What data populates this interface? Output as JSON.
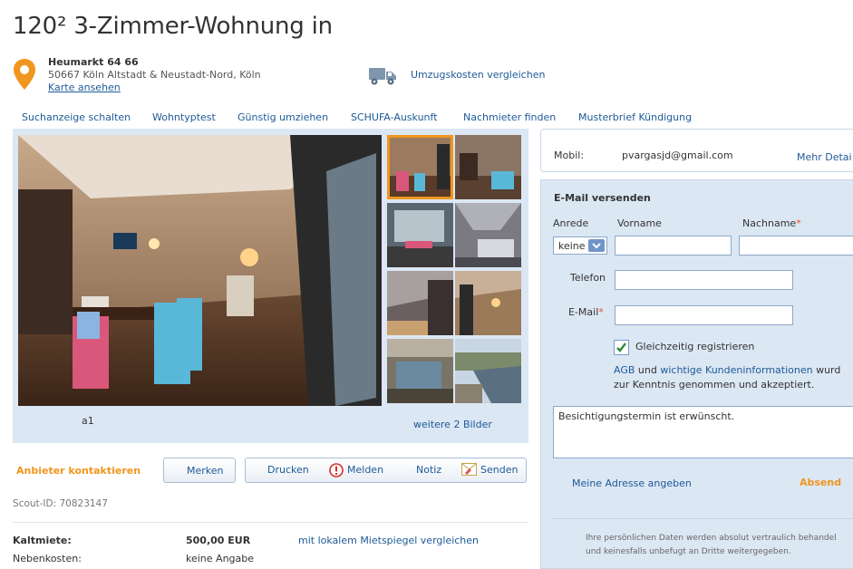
{
  "listing": {
    "title": "120² 3-Zimmer-Wohnung in",
    "street": "Heumarkt 64 66",
    "city": "50667 Köln Altstadt & Neustadt-Nord, Köln",
    "map_link": "Karte ansehen",
    "moving_link": "Umzugskosten vergleichen"
  },
  "nav": {
    "items": [
      "Suchanzeige schalten",
      "Wohntyptest",
      "Günstig umziehen",
      "SCHUFA-Auskunft",
      "Nachmieter finden",
      "Musterbrief Kündigung"
    ]
  },
  "gallery": {
    "caption": "a1",
    "more_link": "weitere 2 Bilder"
  },
  "actions": {
    "contact": "Anbieter kontaktieren",
    "merken": "Merken",
    "drucken": "Drucken",
    "melden": "Melden",
    "notiz": "Notiz",
    "senden": "Senden"
  },
  "scout_id": "Scout-ID: 70823147",
  "costs": {
    "kaltmiete_label": "Kaltmiete:",
    "kaltmiete_value": "500,00 EUR",
    "mietspiegel_link": "mit lokalem Mietspiegel vergleichen",
    "nebenkosten_label": "Nebenkosten:",
    "nebenkosten_value": "keine Angabe"
  },
  "contact": {
    "mobil_label": "Mobil:",
    "mobil_value": "pvargasjd@gmail.com",
    "details_link": "Mehr Detai"
  },
  "email_form": {
    "heading": "E-Mail versenden",
    "anrede_label": "Anrede",
    "anrede_value": "keine",
    "vorname_label": "Vorname",
    "nachname_label": "Nachname",
    "telefon_label": "Telefon",
    "email_label": "E-Mail",
    "register_label": "Gleichzeitig registrieren",
    "register_checked": true,
    "terms_agb": "AGB",
    "terms_und": "und",
    "terms_info": "wichtige Kundeninformationen",
    "terms_wurd": "wurd",
    "terms_line2": "zur Kenntnis genommen und akzeptiert.",
    "message": "Besichtigungstermin ist erwünscht.",
    "address_link": "Meine Adresse angeben",
    "submit": "Absend",
    "privacy_line1": "Ihre persönlichen Daten werden absolut vertraulich behandel",
    "privacy_line2": "und keinesfalls unbefugt an Dritte weitergegeben."
  },
  "colors": {
    "link": "#1d5a97",
    "accent": "#f0961e",
    "panel": "#dce7f4"
  }
}
